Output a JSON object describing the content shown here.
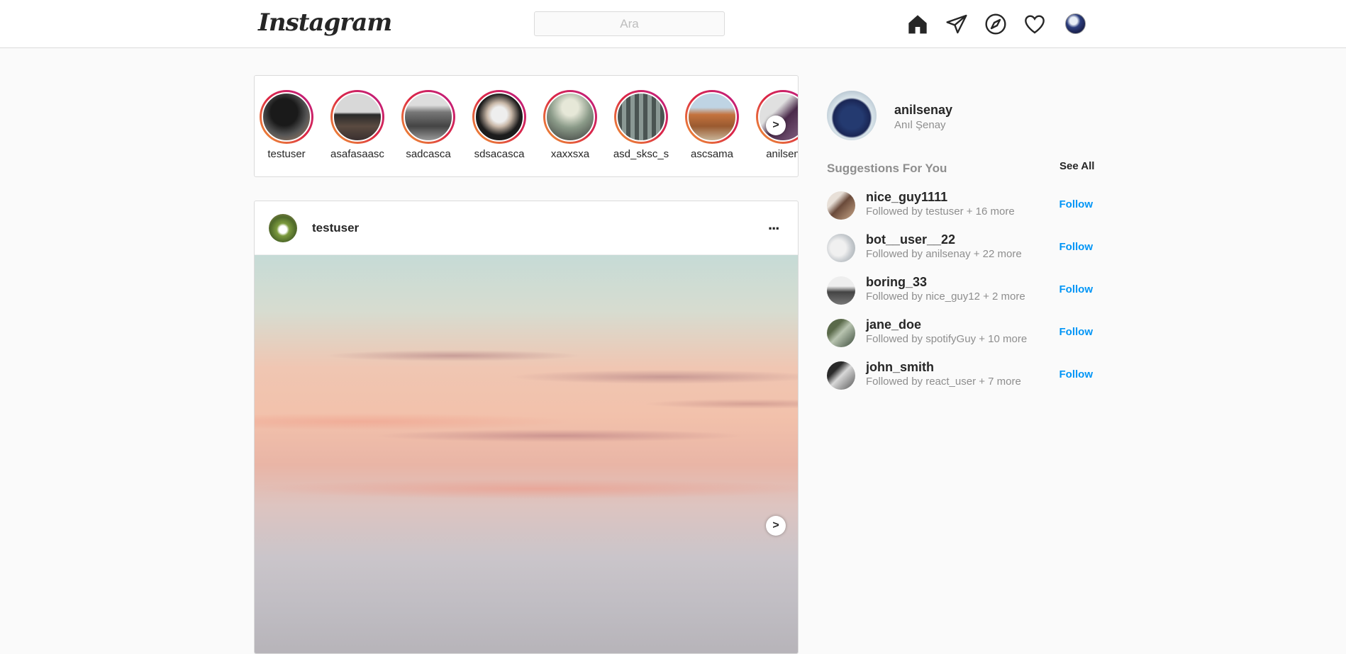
{
  "header": {
    "logo": "Instagram",
    "search_placeholder": "Ara"
  },
  "stories": [
    {
      "username": "testuser",
      "photo": "#3a3a3a"
    },
    {
      "username": "asafasaasc",
      "photo": "#6b6258"
    },
    {
      "username": "sadcasca",
      "photo": "#8a8a8a"
    },
    {
      "username": "sdsacasca",
      "photo": "#2b2b2b"
    },
    {
      "username": "xaxxsxa",
      "photo": "#7a8a78"
    },
    {
      "username": "asd_sksc_s",
      "photo": "#6c7673"
    },
    {
      "username": "ascsama",
      "photo": "#b56a3a"
    },
    {
      "username": "anilsen",
      "photo": "#5a4a6a"
    }
  ],
  "post": {
    "username": "testuser",
    "more": "..."
  },
  "sidebar": {
    "username": "anilsenay",
    "fullname": "Anıl Şenay",
    "suggestions_title": "Suggestions For You",
    "see_all": "See All",
    "suggestions": [
      {
        "username": "nice_guy1111",
        "followed_by": "Followed by testuser + 16 more",
        "action": "Follow"
      },
      {
        "username": "bot__user__22",
        "followed_by": "Followed by anilsenay + 22 more",
        "action": "Follow"
      },
      {
        "username": "boring_33",
        "followed_by": "Followed by nice_guy12 + 2 more",
        "action": "Follow"
      },
      {
        "username": "jane_doe",
        "followed_by": "Followed by spotifyGuy + 10 more",
        "action": "Follow"
      },
      {
        "username": "john_smith",
        "followed_by": "Followed by react_user + 7 more",
        "action": "Follow"
      }
    ]
  },
  "colors": {
    "link_blue": "#0095f6",
    "border": "#dbdbdb",
    "muted": "#8e8e8e"
  },
  "icons": [
    "home-icon",
    "direct-message-icon",
    "explore-icon",
    "activity-heart-icon"
  ]
}
